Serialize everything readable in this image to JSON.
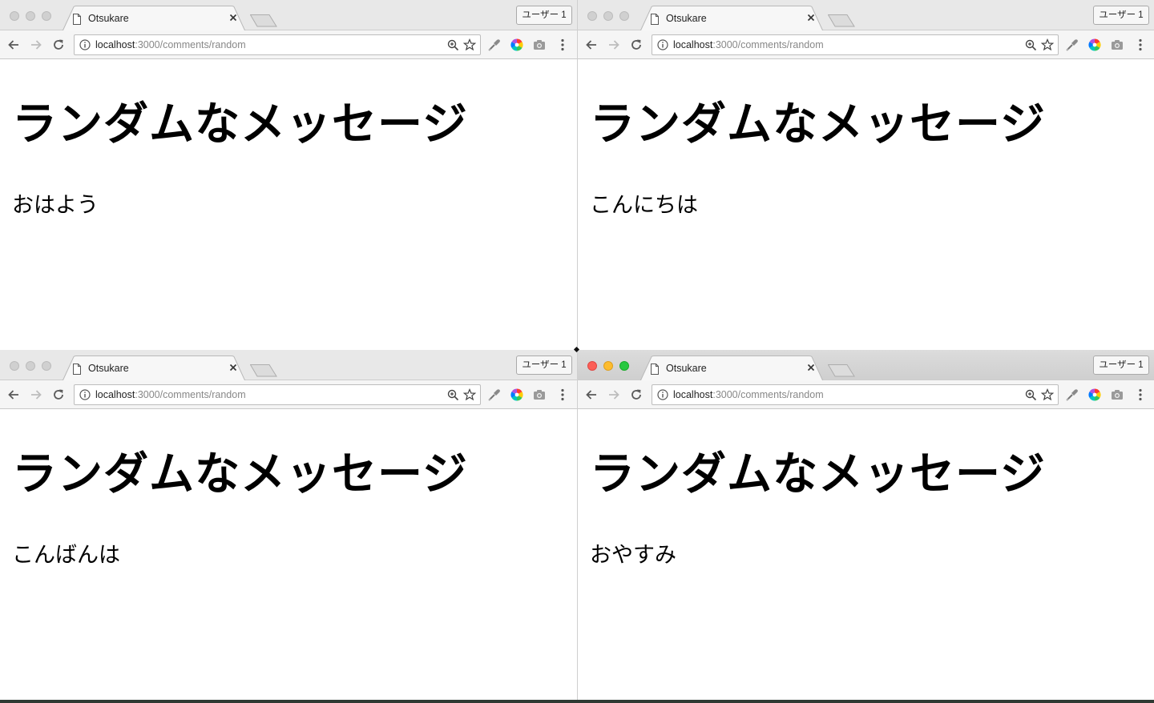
{
  "windows": [
    {
      "position": "top-left",
      "tab_title": "Otsukare",
      "profile_label": "ユーザー 1",
      "url_host": "localhost",
      "url_path": ":3000/comments/random",
      "heading": "ランダムなメッセージ",
      "message": "おはよう",
      "focused": false
    },
    {
      "position": "top-right",
      "tab_title": "Otsukare",
      "profile_label": "ユーザー 1",
      "url_host": "localhost",
      "url_path": ":3000/comments/random",
      "heading": "ランダムなメッセージ",
      "message": "こんにちは",
      "focused": false
    },
    {
      "position": "bottom-left",
      "tab_title": "Otsukare",
      "profile_label": "ユーザー 1",
      "url_host": "localhost",
      "url_path": ":3000/comments/random",
      "heading": "ランダムなメッセージ",
      "message": "こんばんは",
      "focused": false
    },
    {
      "position": "bottom-right",
      "tab_title": "Otsukare",
      "profile_label": "ユーザー 1",
      "url_host": "localhost",
      "url_path": ":3000/comments/random",
      "heading": "ランダムなメッセージ",
      "message": "おやすみ",
      "focused": true
    }
  ],
  "icons": {
    "page": "document-icon",
    "close": "close-icon",
    "back": "back-arrow-icon",
    "forward": "forward-arrow-icon",
    "reload": "reload-icon",
    "info": "info-icon",
    "zoom": "zoom-icon",
    "bookmark": "star-icon",
    "extensions": [
      "eyedropper-extension-icon",
      "color-wheel-extension-icon",
      "camera-extension-icon"
    ],
    "menu": "more-vert-icon"
  },
  "colors": {
    "close_light": "#fc5f57",
    "minimize_light": "#fdbc2e",
    "zoom_light": "#28c840",
    "inactive_light": "#d0d0d0",
    "page_background": "#ffffff"
  }
}
